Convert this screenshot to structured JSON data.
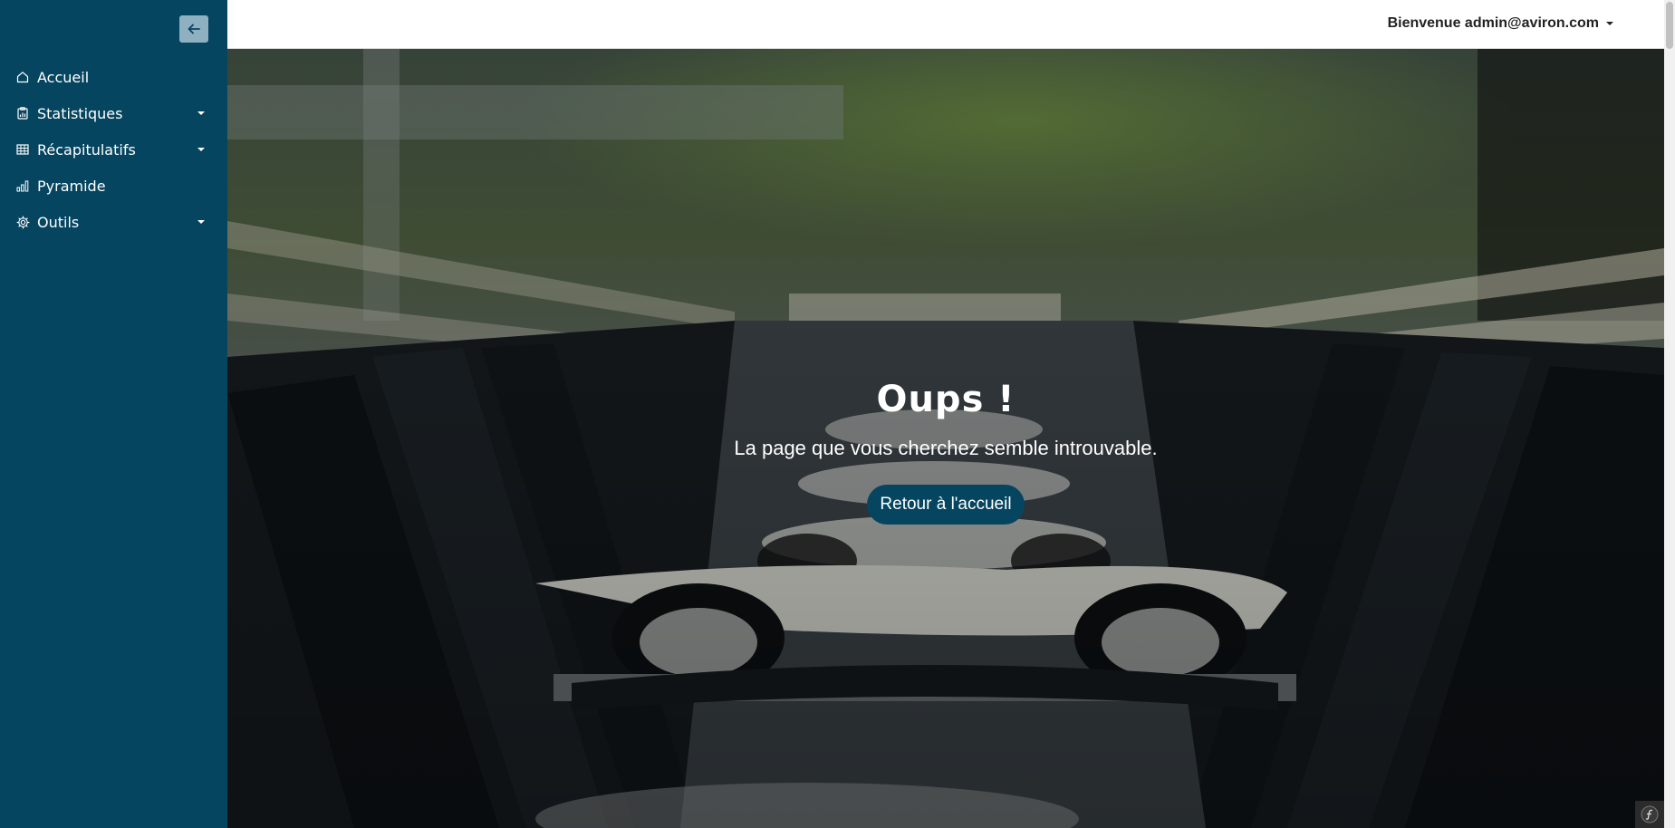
{
  "sidebar": {
    "collapse_icon": "arrow-left-icon",
    "items": [
      {
        "label": "Accueil",
        "icon": "home-icon",
        "has_submenu": false
      },
      {
        "label": "Statistiques",
        "icon": "clipboard-chart-icon",
        "has_submenu": true
      },
      {
        "label": "Récapitulatifs",
        "icon": "table-icon",
        "has_submenu": true
      },
      {
        "label": "Pyramide",
        "icon": "bar-chart-icon",
        "has_submenu": false
      },
      {
        "label": "Outils",
        "icon": "gear-icon",
        "has_submenu": true
      }
    ]
  },
  "header": {
    "user_greeting": "Bienvenue admin@aviron.com"
  },
  "main": {
    "title": "Oups !",
    "subtitle": "La page que vous cherchez semble introuvable.",
    "button_label": "Retour à l'accueil"
  },
  "colors": {
    "sidebar": "#054560",
    "button": "#054560",
    "collapse_button": "#8fb0c1"
  }
}
